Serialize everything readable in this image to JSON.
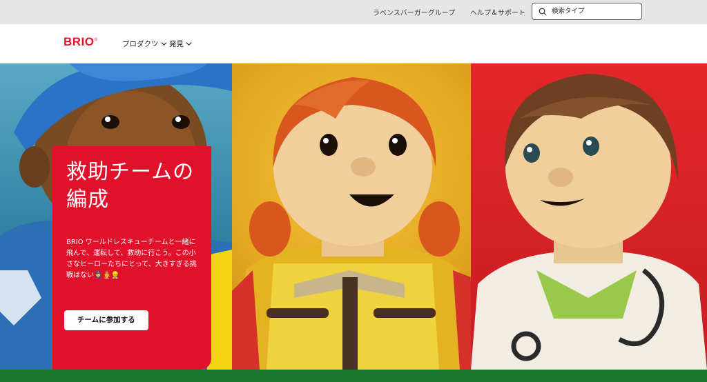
{
  "utility_bar": {
    "group_link": "ラベンスバーガーグループ",
    "help_link": "ヘルプ＆サポート",
    "search_placeholder": "検索タイプ"
  },
  "header": {
    "logo": "BRIO",
    "nav": [
      {
        "label": "プロダクツ"
      },
      {
        "label": "発見"
      }
    ]
  },
  "hero": {
    "title": "救助チームの編成",
    "body": "BRIO ワールドレスキューチームと一緒に飛んで、運転して、救助に行こう。この小さなヒーローたちにとって、大きすぎる挑戦はない👮👨‍🚒👷",
    "cta": "チームに参加する",
    "panels": [
      "blue",
      "yellow",
      "red"
    ]
  },
  "colors": {
    "brand_red": "#e2112b",
    "footer_green": "#1b7a2f",
    "utility_bg": "#e6e6e6"
  }
}
